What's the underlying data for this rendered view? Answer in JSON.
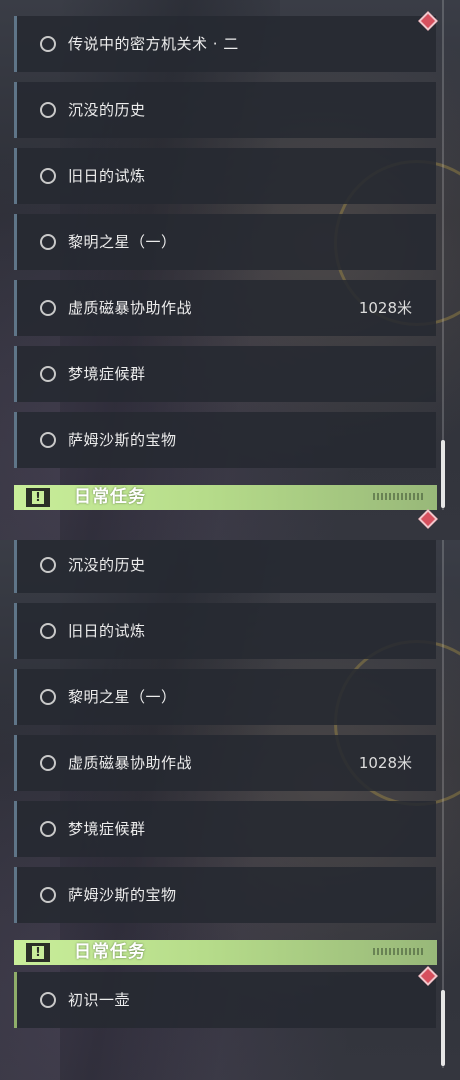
{
  "top_panel": {
    "quests": [
      {
        "label": "传说中的密方机关术 · 二",
        "distance": ""
      },
      {
        "label": "沉没的历史",
        "distance": ""
      },
      {
        "label": "旧日的试炼",
        "distance": ""
      },
      {
        "label": "黎明之星（一）",
        "distance": ""
      },
      {
        "label": "虚质磁暴协助作战",
        "distance": "1028米"
      },
      {
        "label": "梦境症候群",
        "distance": ""
      },
      {
        "label": "萨姆沙斯的宝物",
        "distance": ""
      }
    ],
    "section_header": {
      "icon": "exclamation-icon",
      "title": "日常任务"
    }
  },
  "bottom_panel": {
    "quests": [
      {
        "label": "沉没的历史",
        "distance": ""
      },
      {
        "label": "旧日的试炼",
        "distance": ""
      },
      {
        "label": "黎明之星（一）",
        "distance": ""
      },
      {
        "label": "虚质磁暴协助作战",
        "distance": "1028米"
      },
      {
        "label": "梦境症候群",
        "distance": ""
      },
      {
        "label": "萨姆沙斯的宝物",
        "distance": ""
      }
    ],
    "section_header": {
      "icon": "exclamation-icon",
      "title": "日常任务"
    },
    "daily_quests": [
      {
        "label": "初识一壶",
        "distance": ""
      }
    ]
  },
  "colors": {
    "accent_main": "#5f7588",
    "accent_daily": "#8fae6a",
    "header_green": "#c9ee9a",
    "marker_red": "#d6505e"
  }
}
